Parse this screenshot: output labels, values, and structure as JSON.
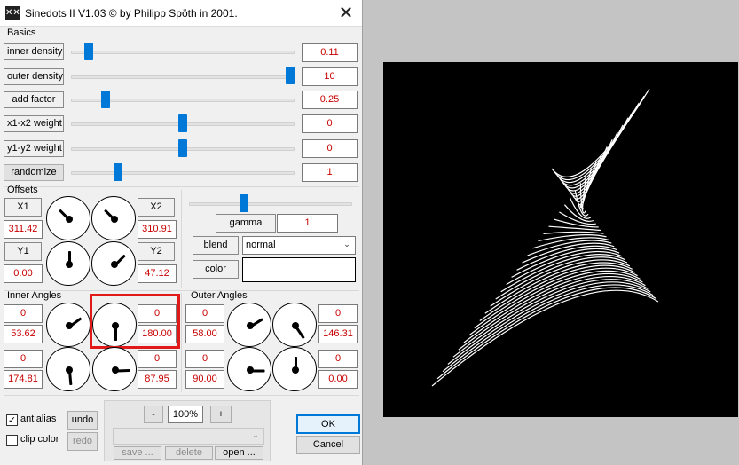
{
  "window": {
    "title": "Sinedots II V1.03 © by Philipp Spöth in 2001.",
    "close_glyph": "✕",
    "icon_glyph": "✕✕"
  },
  "basics": {
    "section_label": "Basics",
    "rows": [
      {
        "label": "inner density",
        "value": "0.11",
        "slider_fraction": 0.06
      },
      {
        "label": "outer density",
        "value": "10",
        "slider_fraction": 1.0
      },
      {
        "label": "add factor",
        "value": "0.25",
        "slider_fraction": 0.14
      },
      {
        "label": "x1-x2 weight",
        "value": "0",
        "slider_fraction": 0.5
      },
      {
        "label": "y1-y2 weight",
        "value": "0",
        "slider_fraction": 0.5
      },
      {
        "label": "randomize",
        "value": "1",
        "slider_fraction": 0.2
      }
    ]
  },
  "offsets": {
    "section_label": "Offsets",
    "x1_label": "X1",
    "x1_value": "311.42",
    "x2_label": "X2",
    "x2_value": "310.91",
    "y1_label": "Y1",
    "y1_value": "0.00",
    "y2_label": "Y2",
    "y2_value": "47.12"
  },
  "render": {
    "gamma_label": "gamma",
    "gamma_value": "1",
    "gamma_slider_fraction": 0.33,
    "blend_label": "blend",
    "blend_value": "normal",
    "color_label": "color",
    "color_value": "#ffffff"
  },
  "inner_angles": {
    "section_label": "Inner Angles",
    "a": {
      "top": "0",
      "bottom": "53.62"
    },
    "b": {
      "top": "0",
      "bottom": "180.00"
    },
    "c": {
      "top": "0",
      "bottom": "174.81"
    },
    "d": {
      "top": "0",
      "bottom": "87.95"
    }
  },
  "outer_angles": {
    "section_label": "Outer Angles",
    "a": {
      "top": "0",
      "bottom": "58.00"
    },
    "b": {
      "top": "0",
      "bottom": "146.31"
    },
    "c": {
      "top": "0",
      "bottom": "90.00"
    },
    "d": {
      "top": "0",
      "bottom": "0.00"
    }
  },
  "options": {
    "antialias_label": "antialias",
    "antialias_checked": true,
    "clip_color_label": "clip color",
    "clip_color_checked": false,
    "undo_label": "undo",
    "redo_label": "redo"
  },
  "zoom": {
    "minus_label": "-",
    "value": "100%",
    "plus_label": "+",
    "save_label": "save ...",
    "delete_label": "delete",
    "open_label": "open ..."
  },
  "actions": {
    "ok_label": "OK",
    "cancel_label": "Cancel"
  }
}
